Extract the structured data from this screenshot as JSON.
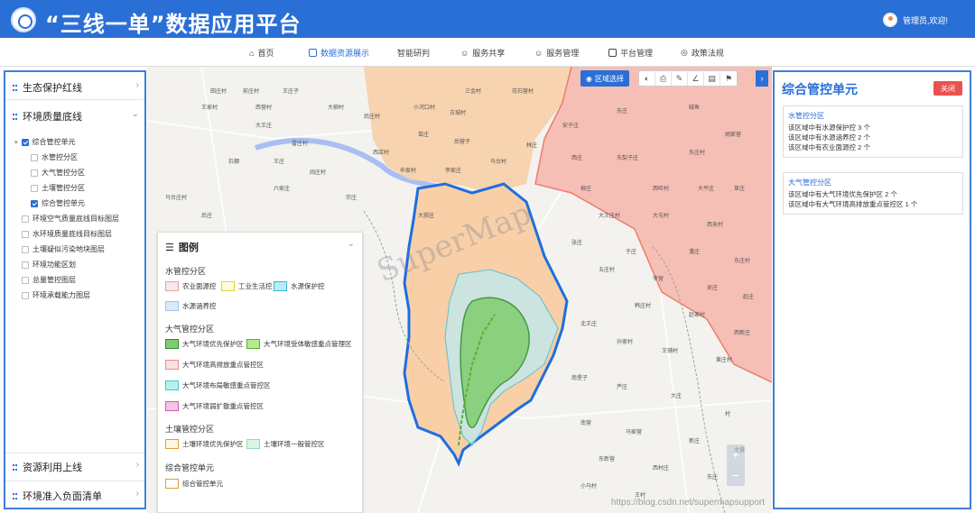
{
  "app": {
    "title": "“三线一单”数据应用平台",
    "user": "管理员,欢迎!"
  },
  "nav": [
    {
      "label": "首页",
      "icon": "home-icon",
      "active": false
    },
    {
      "label": "数据资源展示",
      "icon": "table-icon",
      "active": true
    },
    {
      "label": "智能研判",
      "icon": "",
      "active": false
    },
    {
      "label": "服务共享",
      "icon": "user-icon",
      "active": false
    },
    {
      "label": "服务管理",
      "icon": "user-icon",
      "active": false
    },
    {
      "label": "平台管理",
      "icon": "settings-icon",
      "active": false
    },
    {
      "label": "政策法规",
      "icon": "globe-icon",
      "active": false
    }
  ],
  "sidebar": {
    "sections": [
      {
        "label": "生态保护红线",
        "expanded": false
      },
      {
        "label": "环境质量底线",
        "expanded": true
      },
      {
        "label": "资源利用上线",
        "expanded": false
      },
      {
        "label": "环境准入负面清单",
        "expanded": false
      }
    ],
    "tree": [
      {
        "label": "综合管控单元",
        "checked": true,
        "level": 0,
        "toggle": true
      },
      {
        "label": "水管控分区",
        "checked": false,
        "level": 1
      },
      {
        "label": "大气管控分区",
        "checked": false,
        "level": 1
      },
      {
        "label": "土壤管控分区",
        "checked": false,
        "level": 1
      },
      {
        "label": "综合管控单元",
        "checked": true,
        "level": 1
      },
      {
        "label": "环境空气质量底线目标图层",
        "checked": false,
        "level": 0
      },
      {
        "label": "水环境质量底线目标图层",
        "checked": false,
        "level": 0
      },
      {
        "label": "土壤疑似污染地块图层",
        "checked": false,
        "level": 0
      },
      {
        "label": "环境功能区划",
        "checked": false,
        "level": 0
      },
      {
        "label": "总量管控图层",
        "checked": false,
        "level": 0
      },
      {
        "label": "环境承载能力图层",
        "checked": false,
        "level": 0
      }
    ]
  },
  "map": {
    "region_select": "区域选择",
    "tools": [
      "measure-icon",
      "print-icon",
      "draw-icon",
      "angle-icon",
      "layers-icon",
      "pin-icon"
    ],
    "watermark": "SuperMap",
    "url_watermark": "https://blog.csdn.net/supermapsupport",
    "zoom_in": "+",
    "zoom_out": "−",
    "places": [
      "田庄村",
      "前庄村",
      "王庄子",
      "三金村",
      "花石营村",
      "王家村",
      "西营村",
      "大柳村",
      "小河口村",
      "古城村",
      "后庄村",
      "大王庄",
      "安子庄",
      "东庄",
      "碱鱼",
      "雷庄村",
      "苗庄",
      "后营子",
      "林庄",
      "西店村",
      "石棚",
      "王庄",
      "阎庄村",
      "牟家村",
      "李家庄",
      "马台村",
      "西庄",
      "东梨子庄",
      "东庄村",
      "胡家营",
      "马台庄村",
      "后庄",
      "六家庄",
      "宗庄",
      "大郝庄",
      "柳庄",
      "西旺村",
      "大平庄",
      "草庄",
      "大王庄村",
      "大屯村",
      "西吴村",
      "张庄",
      "于庄",
      "潘庄",
      "东庄村",
      "五庄村",
      "李营",
      "吴庄",
      "赵庄",
      "韩庄村",
      "赵家村",
      "西新庄",
      "北王庄",
      "孙家村",
      "王铺村",
      "黄庄村",
      "南堡子",
      "芦庄",
      "大庄",
      "村",
      "南营",
      "马家营",
      "新庄",
      "北营",
      "东新营",
      "西村庄",
      "东庄",
      "小马村",
      "王村"
    ]
  },
  "legend": {
    "title": "图例",
    "groups": [
      {
        "name": "水管控分区",
        "items": [
          {
            "label": "农业面源控",
            "fill": "#f7e8ea",
            "stroke": "#e3a3aa"
          },
          {
            "label": "工业生活控",
            "fill": "#fdfbe4",
            "stroke": "#e8d22c"
          },
          {
            "label": "水源保护控",
            "fill": "#bdebf4",
            "stroke": "#32b8d6"
          },
          {
            "label": "水源涵养控",
            "fill": "#dbe9f8",
            "stroke": "#9cc3ec"
          }
        ]
      },
      {
        "name": "大气管控分区",
        "items": [
          {
            "label": "大气环境优先保护区",
            "fill": "#7fcd6e",
            "stroke": "#2e8b2e"
          },
          {
            "label": "大气环境受体敏感重点管理区",
            "fill": "#b5e98c",
            "stroke": "#5db02c"
          },
          {
            "label": "大气环境高排放重点管控区",
            "fill": "#fce0e2",
            "stroke": "#e58e94"
          },
          {
            "label": "大气环境布局敏感重点管控区",
            "fill": "#b6f1ee",
            "stroke": "#3ecdc6"
          },
          {
            "label": "大气环境弱扩散重点管控区",
            "fill": "#f6c4e6",
            "stroke": "#d35ab3"
          }
        ]
      },
      {
        "name": "土壤管控分区",
        "items": [
          {
            "label": "土壤环境优先保护区",
            "fill": "#fff6e2",
            "stroke": "#e0a03a"
          },
          {
            "label": "土壤环境一般管控区",
            "fill": "#d9f6e4",
            "stroke": "#97dcb0"
          }
        ]
      },
      {
        "name": "综合管控单元",
        "items": [
          {
            "label": "综合管控单元",
            "fill": "#ffffff",
            "stroke": "#e0a03a"
          }
        ]
      }
    ]
  },
  "panel": {
    "title": "综合管控单元",
    "close": "关闭",
    "cards": [
      {
        "title": "水管控分区",
        "lines": [
          "该区域中有水源保护控 3 个",
          "该区域中有水源涵养控 2 个",
          "该区域中有农业面源控 2 个"
        ]
      },
      {
        "title": "大气管控分区",
        "lines": [
          "该区域中有大气环境优先保护区 2 个",
          "该区域中有大气环境高排放重点管控区 1 个"
        ]
      }
    ]
  },
  "colors": {
    "primary": "#2a6fd6",
    "map_peach": "#f8cfa7",
    "map_pink": "#f6b9ae",
    "boundary": "#1f6ee0",
    "water": "#a9bff3"
  }
}
